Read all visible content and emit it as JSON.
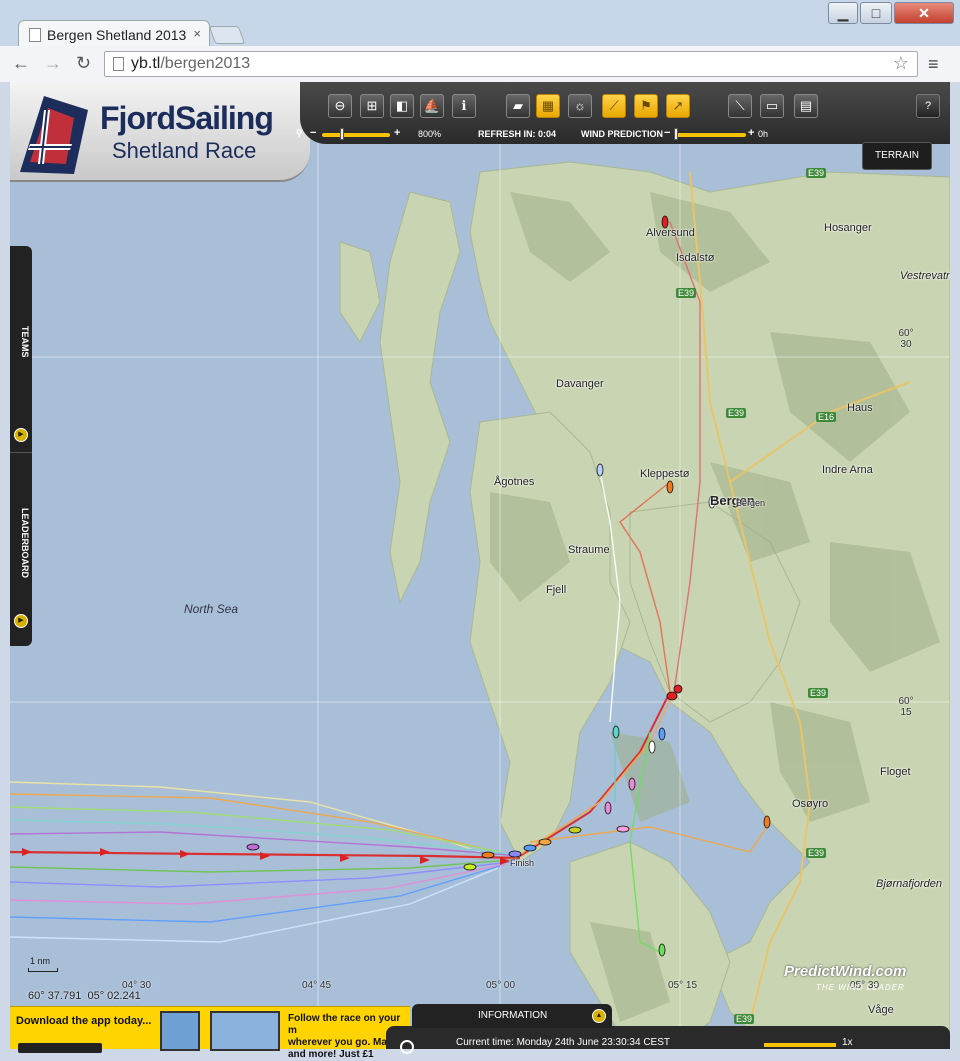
{
  "browser": {
    "tab_title": "Bergen Shetland 2013",
    "tab_close": "×",
    "url_host": "yb.tl",
    "url_path": "/bergen2013",
    "back": "←",
    "forward": "→",
    "reload": "↻",
    "star": "☆",
    "menu": "≡",
    "min": "▁",
    "max": "□",
    "close": "✕"
  },
  "logo": {
    "title": "FjordSailing",
    "subtitle": "Shetland Race"
  },
  "controls": {
    "zoom_out": "−",
    "zoom_in": "+",
    "zoom_label": "800%",
    "refresh_label": "REFRESH IN: 0:04",
    "wind_label": "WIND PREDICTION",
    "wind_minus": "−",
    "wind_plus": "+",
    "wind_hours": "0h",
    "help": "?",
    "terrain": "TERRAIN",
    "zoom_value_fraction": 0.3,
    "wind_value_fraction": 0.0
  },
  "icons": {
    "zoom_out_icon": "⊖",
    "zoom_box_icon": "⊞",
    "layers_icon": "◧",
    "boat_icon": "⛵",
    "info_icon": "ℹ",
    "terrain_icon": "▰",
    "grid_icon": "▦",
    "sun_icon": "☼",
    "ruler_icon": "⟋",
    "flag_icon": "⚑",
    "wind_icon": "↗",
    "measure_icon": "⟍",
    "tablet_icon": "▭",
    "chat_icon": "▤"
  },
  "side": {
    "teams": "TEAMS",
    "leaderboard": "LEADERBOARD",
    "arrow": "▶"
  },
  "places": {
    "alversund": "Alversund",
    "isdalsto": "Isdalstø",
    "hosanger": "Hosanger",
    "vestrevatn": "Vestrevatn",
    "davanger": "Davanger",
    "haus": "Haus",
    "kleppesto": "Kleppestø",
    "bergen": "Bergen",
    "bergen_small": "Bergen",
    "indre_arna": "Indre Arna",
    "agotnes": "Ågotnes",
    "straume": "Straume",
    "fjell": "Fjell",
    "north_sea": "North Sea",
    "floget": "Floget",
    "osoyro": "Osøyro",
    "bjornafjorden": "Bjørnafjorden",
    "vage": "Våge",
    "finish": "Finish"
  },
  "roads": {
    "e39_a": "E39",
    "e39_b": "E39",
    "e39_c": "E39",
    "e16": "E16",
    "e39_d": "E39",
    "e39_e": "E39",
    "e39_f": "E39"
  },
  "coords": {
    "lat_30": "60°\n30",
    "lat_15": "60°\n15",
    "lon_0430": "04° 30",
    "lon_0445": "04° 45",
    "lon_0500": "05° 00",
    "lon_0515": "05° 15",
    "lon_0530": "05° 30",
    "scale": "1 nm",
    "cursor_lat": "60° 37.791",
    "cursor_lon": "05° 02.241"
  },
  "bottom": {
    "ad_left": "Download the app today...",
    "ad_right_1": "Follow the race on your m",
    "ad_right_2": "wherever you go. Ma",
    "ad_right_3": "and more! Just £1",
    "info": "INFORMATION",
    "info_arrow": "▲",
    "current_time": "Current time: Monday 24th June 23:30:34 CEST",
    "speed": "1x",
    "predict": "PredictWind.com",
    "predict_sub": "THE WIND LEADER"
  }
}
